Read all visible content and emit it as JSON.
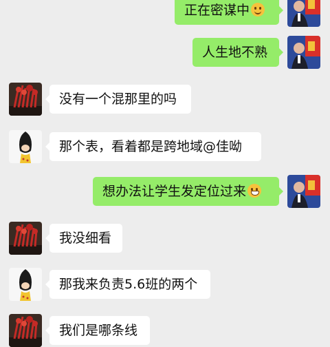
{
  "messages": [
    {
      "side": "out",
      "avatar": "politician-photo",
      "text": "正在密谋中",
      "emoji": "thinking-emoji"
    },
    {
      "side": "out",
      "avatar": "politician-photo",
      "text": "人生地不熟",
      "emoji": ""
    },
    {
      "side": "in",
      "avatar": "red-branches-photo",
      "text": "没有一个混那里的吗",
      "emoji": ""
    },
    {
      "side": "in",
      "avatar": "cartoon-girl-avatar",
      "text": "那个表，看着都是跨地域@佳呦",
      "emoji": ""
    },
    {
      "side": "out",
      "avatar": "politician-photo",
      "text": "想办法让学生发定位过来",
      "emoji": "grin-emoji"
    },
    {
      "side": "in",
      "avatar": "red-branches-photo",
      "text": "我没细看",
      "emoji": ""
    },
    {
      "side": "in",
      "avatar": "cartoon-girl-avatar",
      "text": "那我来负责5.6班的两个",
      "emoji": ""
    },
    {
      "side": "in",
      "avatar": "red-branches-photo",
      "text": "我们是哪条线",
      "emoji": ""
    }
  ],
  "colors": {
    "background": "#ededed",
    "outgoing_bubble": "#95ec69",
    "incoming_bubble": "#ffffff"
  }
}
